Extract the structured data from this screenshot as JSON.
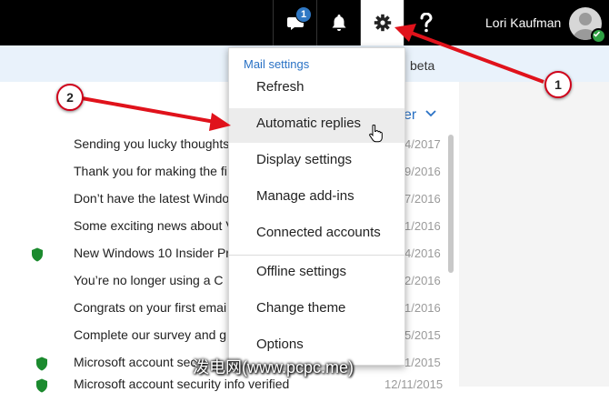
{
  "colors": {
    "topbar": "#000000",
    "accent": "#2a72c5",
    "arrow": "#e0121b",
    "safe": "#1b8a2e"
  },
  "header": {
    "chat_badge": "1",
    "username": "Lori Kaufman",
    "icons": [
      "chat-icon",
      "bell-icon",
      "gear-icon",
      "help-icon"
    ]
  },
  "banner": {
    "text": "beta"
  },
  "filter": {
    "label": "er"
  },
  "messages": [
    {
      "subject": "Sending you lucky thoughts",
      "date": "4/2017",
      "safe": false
    },
    {
      "subject": "Thank you for making the fi",
      "date": "9/2016",
      "safe": false
    },
    {
      "subject": "Don’t have the latest Windo",
      "date": "7/2016",
      "safe": false
    },
    {
      "subject": "Some exciting news about V",
      "date": "1/2016",
      "safe": false
    },
    {
      "subject": "New Windows 10 Insider Pr",
      "date": "4/2016",
      "safe": true
    },
    {
      "subject": "You’re no longer using a C",
      "date": "2/2016",
      "safe": false
    },
    {
      "subject": "Congrats on your first emai",
      "date": "1/2016",
      "safe": false
    },
    {
      "subject": "Complete our survey and g",
      "date": "5/2015",
      "safe": false
    },
    {
      "subject": "Microsoft account sec",
      "date": "1/2015",
      "safe": true
    },
    {
      "subject": "Microsoft account security info verified",
      "date": "12/11/2015",
      "safe": true
    }
  ],
  "settings_menu": {
    "heading": "Mail settings",
    "items": [
      {
        "label": "Refresh"
      },
      {
        "label": "Automatic replies"
      },
      {
        "label": "Display settings"
      },
      {
        "label": "Manage add-ins"
      },
      {
        "label": "Connected accounts"
      },
      {
        "label": "Offline settings"
      },
      {
        "label": "Change theme"
      },
      {
        "label": "Options"
      }
    ]
  },
  "annotations": {
    "callout_1": "1",
    "callout_2": "2"
  },
  "watermark": "泼电网(www.pcpc.me)"
}
